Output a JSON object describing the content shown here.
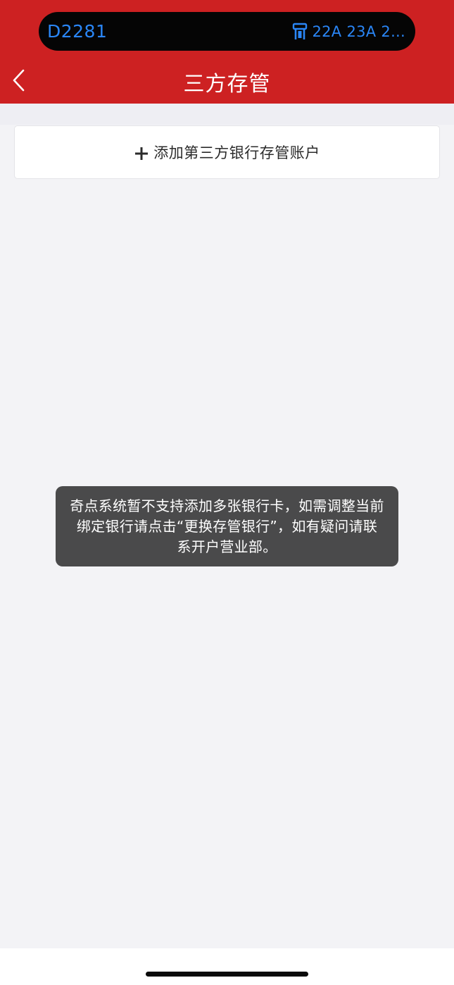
{
  "status_island": {
    "train_number": "D2281",
    "seats": "22A 23A 2...",
    "icon": "train-seat-icon"
  },
  "nav": {
    "back_icon": "chevron-left-icon",
    "title": "三方存管"
  },
  "add_account": {
    "icon": "plus-icon",
    "label": "添加第三方银行存管账户"
  },
  "toast": {
    "message": "奇点系统暂不支持添加多张银行卡，如需调整当前绑定银行请点击“更换存管银行”，如有疑问请联系开户营业部。"
  },
  "colors": {
    "header_red": "#cd2122",
    "accent_blue": "#2a86f6",
    "background": "#f3f3f6",
    "toast_bg": "#4a4a4b"
  }
}
